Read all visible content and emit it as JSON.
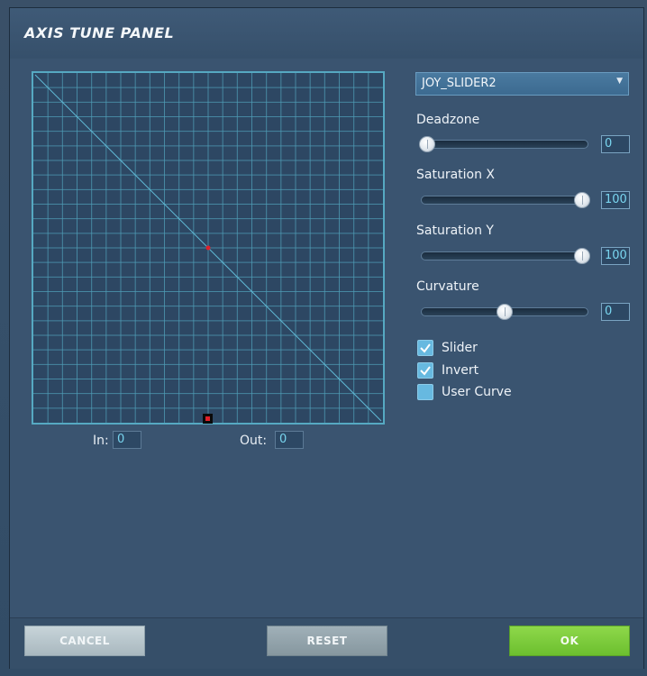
{
  "dialog": {
    "title": "AXIS TUNE PANEL"
  },
  "graph": {
    "in_label": "In:",
    "in_value": "0",
    "out_label": "Out:",
    "out_value": "0",
    "curve_color": "#5fb8d4",
    "point_color": "#e0202a"
  },
  "axis_select": {
    "selected": "JOY_SLIDER2"
  },
  "controls": {
    "deadzone": {
      "label": "Deadzone",
      "value": "0",
      "level": 0
    },
    "saturation_x": {
      "label": "Saturation X",
      "value": "100",
      "level": 100
    },
    "saturation_y": {
      "label": "Saturation Y",
      "value": "100",
      "level": 100
    },
    "curvature": {
      "label": "Curvature",
      "value": "0",
      "level": 50
    }
  },
  "options": {
    "slider": {
      "label": "Slider",
      "checked": true
    },
    "invert": {
      "label": "Invert",
      "checked": true
    },
    "user_curve": {
      "label": "User Curve",
      "checked": false
    }
  },
  "footer": {
    "cancel_label": "CANCEL",
    "reset_label": "RESET",
    "ok_label": "OK",
    "ok_color": "#7ccc3a"
  }
}
